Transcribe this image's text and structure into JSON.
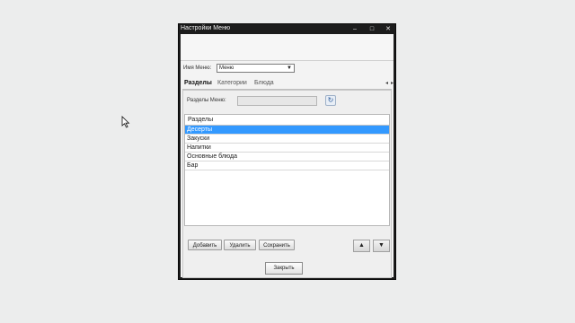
{
  "window": {
    "title": "Настройки Меню",
    "controls": {
      "minimize": "–",
      "maximize": "□",
      "close": "✕"
    }
  },
  "menu_name": {
    "label": "Имя Меню:",
    "value": "Меню"
  },
  "tabs": [
    {
      "label": "Разделы",
      "active": true
    },
    {
      "label": "Категории",
      "active": false
    },
    {
      "label": "Блюда",
      "active": false
    }
  ],
  "tab_nav": {
    "prev": "◂",
    "next": "▸"
  },
  "sections": {
    "field_label": "Разделы Меню:",
    "field_value": "",
    "column_header": "Разделы",
    "items": [
      "Десерты",
      "Закуски",
      "Напитки",
      "Основные блюда",
      "Бар"
    ],
    "selected_index": 0
  },
  "buttons": {
    "add": "Добавить",
    "delete": "Удалить",
    "save": "Сохранить",
    "up": "▲",
    "down": "▼",
    "close": "Закрыть"
  },
  "colors": {
    "selection": "#3399ff",
    "titlebar": "#1c1c1c"
  },
  "icons": {
    "cursor": "arrow-cursor-icon",
    "sec_btn": "refresh-icon"
  }
}
